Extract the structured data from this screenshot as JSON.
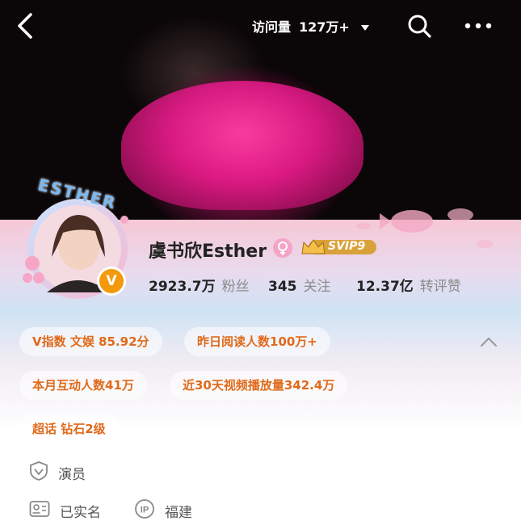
{
  "header": {
    "visits_label": "访问量",
    "visits_value": "127万+"
  },
  "profile": {
    "name": "虞书欣Esther",
    "avatar_badge": "ESTHER",
    "verified_badge": "V",
    "vip_label": "SVIP9",
    "stats": [
      {
        "value": "2923.7万",
        "label": "粉丝"
      },
      {
        "value": "345",
        "label": "关注"
      },
      {
        "value": "12.37亿",
        "label": "转评赞"
      }
    ]
  },
  "tags": {
    "v_index": "V指数  文娱  85.92分",
    "yesterday_reads": "昨日阅读人数100万+",
    "monthly_interactions": "本月互动人数41万",
    "video_plays": "近30天视频播放量342.4万",
    "supertopic": "超话  钻石2级"
  },
  "info": {
    "occupation": "演员",
    "realname": "已实名",
    "ip_location": "福建"
  },
  "colors": {
    "accent_orange": "#e06a1a",
    "cover_pink": "#e01a86",
    "verified_orange": "#f39a0c"
  }
}
